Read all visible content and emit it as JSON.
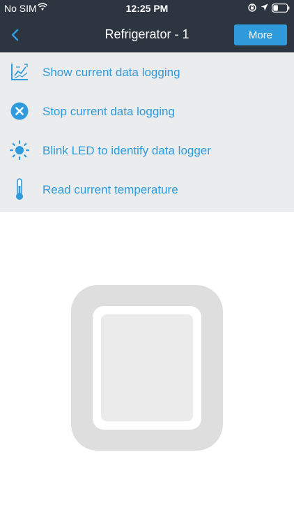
{
  "status_bar": {
    "carrier": "No SIM",
    "time": "12:25 PM"
  },
  "nav": {
    "title": "Refrigerator - 1",
    "more_label": "More"
  },
  "menu": {
    "items": [
      {
        "label": "Show current data logging",
        "icon": "chart-icon"
      },
      {
        "label": "Stop current data logging",
        "icon": "stop-circle-icon"
      },
      {
        "label": "Blink LED to identify data logger",
        "icon": "sun-icon"
      },
      {
        "label": "Read current temperature",
        "icon": "thermometer-icon"
      }
    ]
  },
  "colors": {
    "accent": "#2f9bdc",
    "header_bg": "#2d3640",
    "menu_bg": "#ebeced",
    "device_frame": "#dedede"
  }
}
